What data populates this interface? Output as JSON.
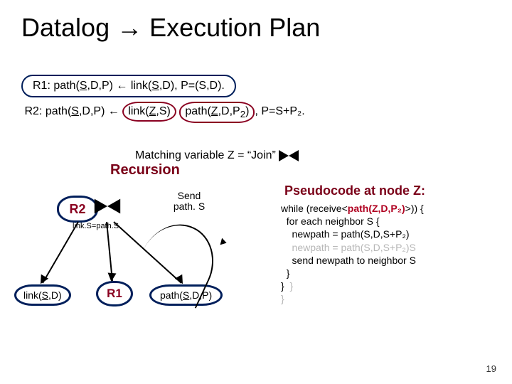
{
  "title": "Datalog → Execution Plan",
  "rules": {
    "r1_label": "R1:",
    "r1_body": "path(S,D,P) ← link(S,D), P=(S,D).",
    "r2_label": "R2:",
    "r2_pre": "path(S,D,P) ← ",
    "r2_link": "link(Z,S)",
    "r2_path": "path(Z,D,P₂)",
    "r2_tail": ", P=S+P₂."
  },
  "matching": "Matching variable Z = “Join”",
  "recursion_label": "Recursion",
  "tree": {
    "r2": "R2",
    "join_cond": "link.S=path.S",
    "r1": "R1",
    "leaf_link": "link(S,D)",
    "leaf_path": "path(S,D,P)",
    "send": "Send\npath.\nS"
  },
  "pseudocode": {
    "title": "Pseudocode at node Z:",
    "l1_a": "while (receive<",
    "l1_b": "path(Z,D,P₂)",
    "l1_c": ">)) {",
    "l2": "  for each neighbor S {",
    "l3": "    newpath = path(S,D,S+P₂)",
    "l4": "    send newpath to neighbor S",
    "l5": "  }",
    "l6": "}",
    "g3": "    newpath = path(S,D,S+P₂)S",
    "g6a": "  }",
    "g6b": "}"
  },
  "page": "19"
}
